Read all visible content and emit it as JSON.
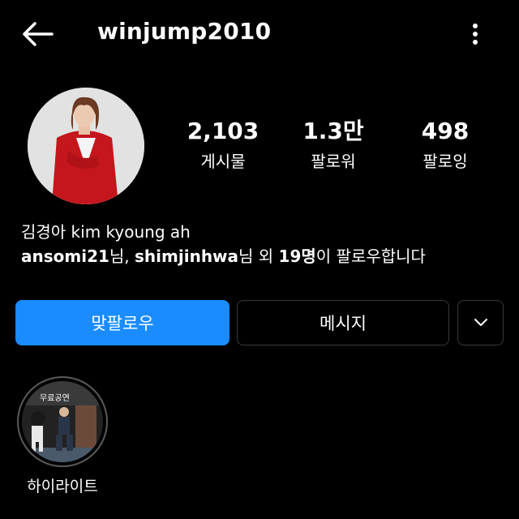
{
  "header": {
    "username": "winjump2010",
    "back_icon": "arrow-left-icon",
    "menu_icon": "more-vertical-icon"
  },
  "stats": [
    {
      "value": "2,103",
      "label": "게시물"
    },
    {
      "value": "1.3만",
      "label": "팔로워"
    },
    {
      "value": "498",
      "label": "팔로잉"
    }
  ],
  "bio": {
    "name": "김경아 kim kyoung ah",
    "followed_by": {
      "user1": "ansomi21",
      "suffix1": "님, ",
      "user2": "shimjinhwa",
      "suffix2": "님 외 ",
      "count": "19명",
      "suffix3": "이 팔로우합니다"
    }
  },
  "actions": {
    "follow_back": "맞팔로우",
    "message": "메시지",
    "more_icon": "chevron-down-icon"
  },
  "highlights": [
    {
      "label": "하이라이트",
      "cover_text": "무료공연"
    }
  ],
  "colors": {
    "background": "#000000",
    "primary_button": "#1a8cff",
    "border": "#3a3a3a",
    "text": "#ffffff"
  }
}
